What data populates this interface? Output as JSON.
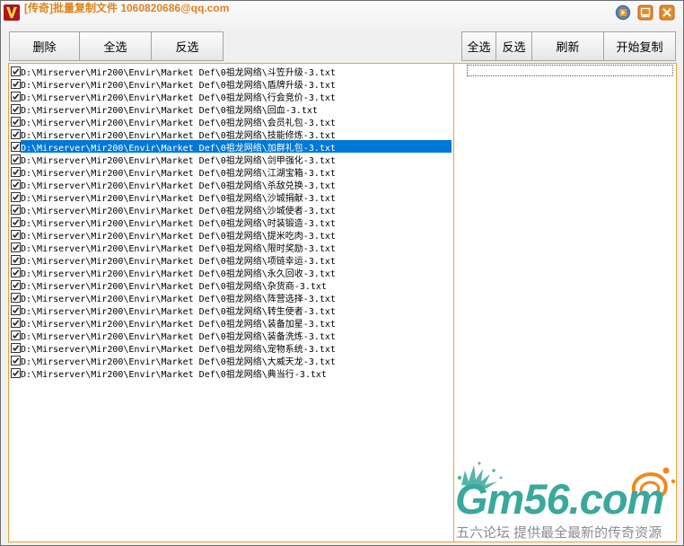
{
  "window": {
    "title": "[传奇]批量复制文件 1060820686@qq.com"
  },
  "icons": {
    "app": "app-icon",
    "help": "help-icon",
    "minimize": "minimize-icon",
    "close": "close-icon",
    "checkbox_mark": "checkmark-icon"
  },
  "colors": {
    "title_text": "#e0831a",
    "panel_border": "#eaa23c",
    "selection": "#0078d7",
    "watermark_teal": "#3aa89c",
    "watermark_orange": "#f0891e",
    "watermark_tagline": "#8c8c8c"
  },
  "left_toolbar": {
    "delete_label": "删除",
    "select_all_label": "全选",
    "invert_label": "反选"
  },
  "right_toolbar": {
    "select_all_label": "全选",
    "invert_label": "反选",
    "refresh_label": "刷新",
    "start_copy_label": "开始复制"
  },
  "source_list": {
    "selected_index": 6,
    "items": [
      {
        "path": "D:\\Mirserver\\Mir200\\Envir\\Market_Def\\0祖龙网络\\斗笠升级-3.txt",
        "checked": true
      },
      {
        "path": "D:\\Mirserver\\Mir200\\Envir\\Market_Def\\0祖龙网络\\盾牌升级-3.txt",
        "checked": true
      },
      {
        "path": "D:\\Mirserver\\Mir200\\Envir\\Market_Def\\0祖龙网络\\行会竞价-3.txt",
        "checked": true
      },
      {
        "path": "D:\\Mirserver\\Mir200\\Envir\\Market_Def\\0祖龙网络\\回血-3.txt",
        "checked": true
      },
      {
        "path": "D:\\Mirserver\\Mir200\\Envir\\Market_Def\\0祖龙网络\\会员礼包-3.txt",
        "checked": true
      },
      {
        "path": "D:\\Mirserver\\Mir200\\Envir\\Market_Def\\0祖龙网络\\技能修炼-3.txt",
        "checked": true
      },
      {
        "path": "D:\\Mirserver\\Mir200\\Envir\\Market_Def\\0祖龙网络\\加群礼包-3.txt",
        "checked": true
      },
      {
        "path": "D:\\Mirserver\\Mir200\\Envir\\Market_Def\\0祖龙网络\\剑甲强化-3.txt",
        "checked": true
      },
      {
        "path": "D:\\Mirserver\\Mir200\\Envir\\Market_Def\\0祖龙网络\\江湖宝箱-3.txt",
        "checked": true
      },
      {
        "path": "D:\\Mirserver\\Mir200\\Envir\\Market_Def\\0祖龙网络\\杀敌兑换-3.txt",
        "checked": true
      },
      {
        "path": "D:\\Mirserver\\Mir200\\Envir\\Market_Def\\0祖龙网络\\沙城捐献-3.txt",
        "checked": true
      },
      {
        "path": "D:\\Mirserver\\Mir200\\Envir\\Market_Def\\0祖龙网络\\沙城使者-3.txt",
        "checked": true
      },
      {
        "path": "D:\\Mirserver\\Mir200\\Envir\\Market_Def\\0祖龙网络\\时装锻造-3.txt",
        "checked": true
      },
      {
        "path": "D:\\Mirserver\\Mir200\\Envir\\Market_Def\\0祖龙网络\\提米吃肉-3.txt",
        "checked": true
      },
      {
        "path": "D:\\Mirserver\\Mir200\\Envir\\Market_Def\\0祖龙网络\\限时奖励-3.txt",
        "checked": true
      },
      {
        "path": "D:\\Mirserver\\Mir200\\Envir\\Market_Def\\0祖龙网络\\项链幸运-3.txt",
        "checked": true
      },
      {
        "path": "D:\\Mirserver\\Mir200\\Envir\\Market_Def\\0祖龙网络\\永久回收-3.txt",
        "checked": true
      },
      {
        "path": "D:\\Mirserver\\Mir200\\Envir\\Market_Def\\0祖龙网络\\杂货商-3.txt",
        "checked": true
      },
      {
        "path": "D:\\Mirserver\\Mir200\\Envir\\Market_Def\\0祖龙网络\\阵营选择-3.txt",
        "checked": true
      },
      {
        "path": "D:\\Mirserver\\Mir200\\Envir\\Market_Def\\0祖龙网络\\转生使者-3.txt",
        "checked": true
      },
      {
        "path": "D:\\Mirserver\\Mir200\\Envir\\Market_Def\\0祖龙网络\\装备加星-3.txt",
        "checked": true
      },
      {
        "path": "D:\\Mirserver\\Mir200\\Envir\\Market_Def\\0祖龙网络\\装备洗炼-3.txt",
        "checked": true
      },
      {
        "path": "D:\\Mirserver\\Mir200\\Envir\\Market_Def\\0祖龙网络\\宠物系统-3.txt",
        "checked": true
      },
      {
        "path": "D:\\Mirserver\\Mir200\\Envir\\Market_Def\\0祖龙网络\\大威天龙-3.txt",
        "checked": true
      },
      {
        "path": "D:\\Mirserver\\Mir200\\Envir\\Market_Def\\0祖龙网络\\典当行-3.txt",
        "checked": true
      }
    ]
  },
  "target_list": {
    "items": []
  },
  "watermark": {
    "logo": "Gm56.com",
    "tagline": "五六论坛 提供最全最新的传奇资源"
  }
}
